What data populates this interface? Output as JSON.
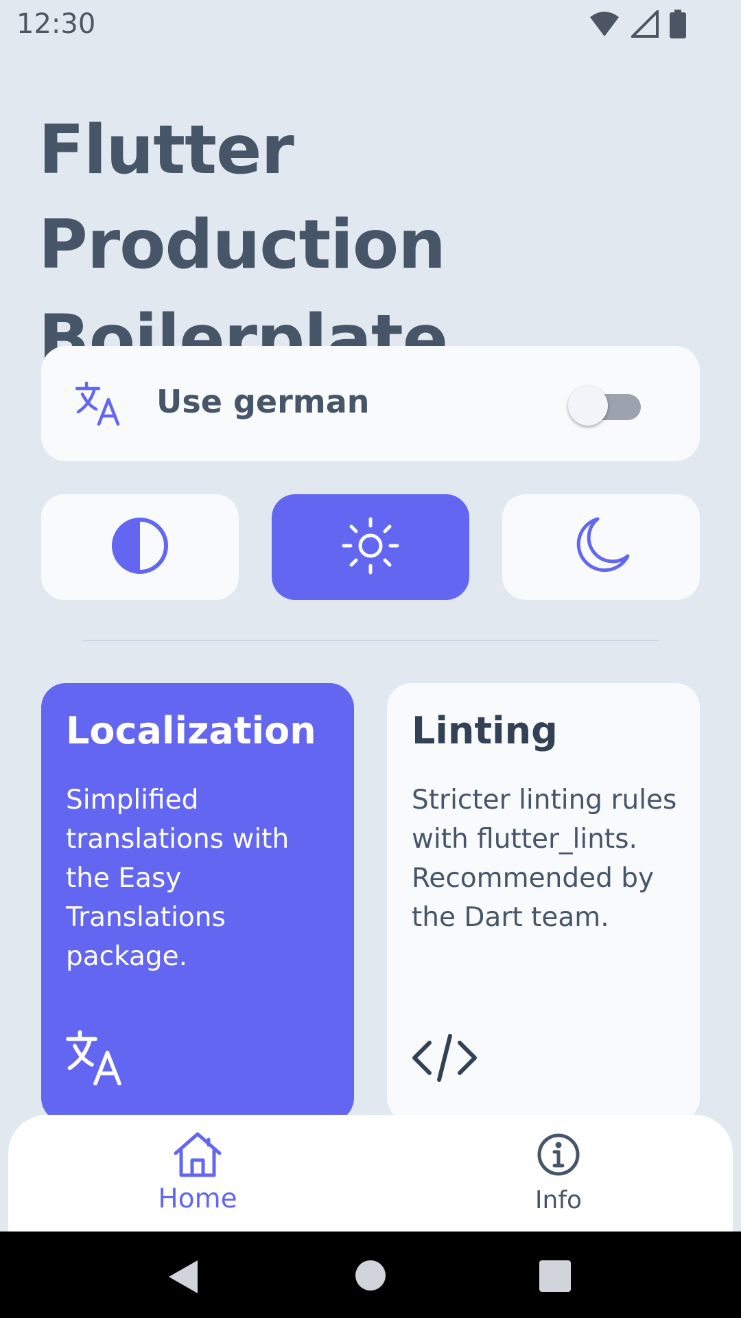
{
  "status_bar": {
    "time": "12:30",
    "icons": [
      "wifi-icon",
      "cell-signal-icon",
      "battery-icon"
    ]
  },
  "header": {
    "title": "Flutter Production Boilerplate"
  },
  "language_card": {
    "icon": "translate-icon",
    "label": "Use german",
    "toggle_on": false
  },
  "theme_selector": {
    "options": [
      {
        "id": "system",
        "icon": "contrast-icon",
        "selected": false
      },
      {
        "id": "light",
        "icon": "sun-icon",
        "selected": true
      },
      {
        "id": "dark",
        "icon": "moon-icon",
        "selected": false
      }
    ]
  },
  "features": [
    {
      "title": "Localization",
      "description": "Simplified translations with the Easy Translations package.",
      "icon": "translate-icon",
      "highlighted": true
    },
    {
      "title": "Linting",
      "description": "Stricter linting rules with flutter_lints. Recommended by the Dart team.",
      "icon": "code-icon",
      "highlighted": false
    }
  ],
  "bottom_nav": {
    "items": [
      {
        "label": "Home",
        "icon": "home-icon",
        "active": true
      },
      {
        "label": "Info",
        "icon": "info-icon",
        "active": false
      }
    ]
  },
  "colors": {
    "background": "#e2e8f0",
    "card": "#f8fafc",
    "accent": "#6366f1",
    "text": "#475569"
  }
}
